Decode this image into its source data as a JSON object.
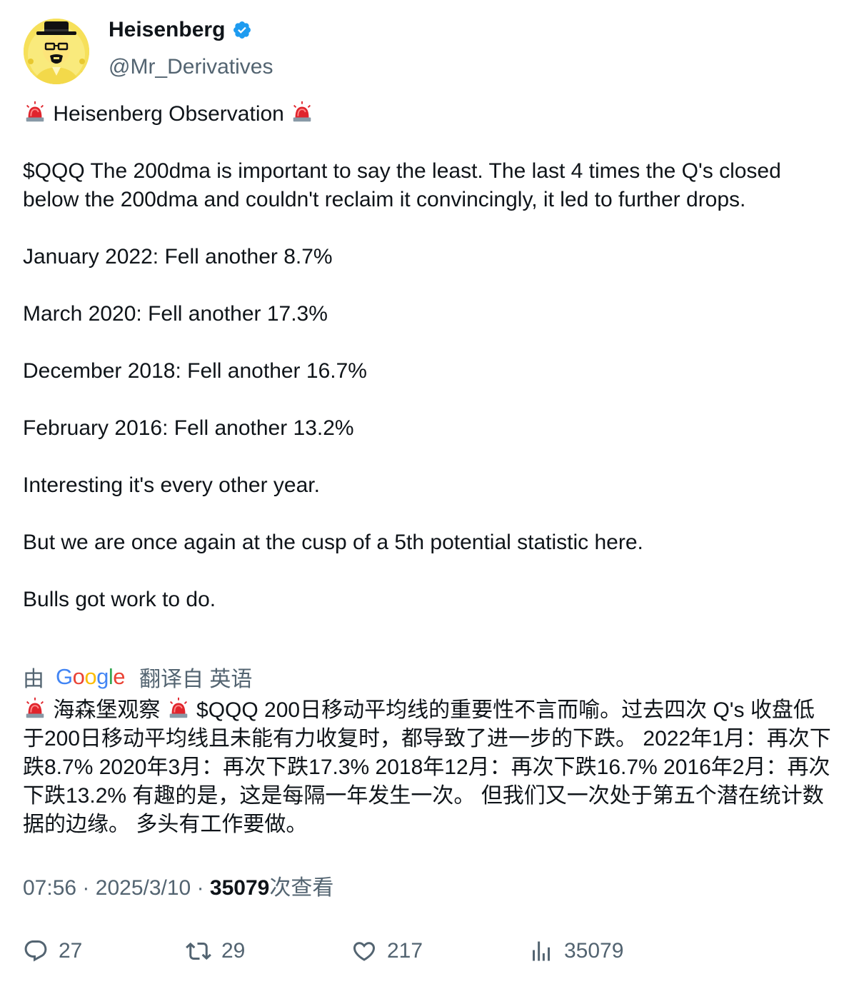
{
  "author": {
    "display_name": "Heisenberg",
    "handle": "@Mr_Derivatives",
    "verified": true,
    "avatar_icon": "heisenberg-avatar-icon"
  },
  "tweet": {
    "heading": "Heisenberg Observation",
    "paragraph1": "$QQQ The 200dma is important to say the least. The last 4 times the Q's closed below the 200dma and couldn't reclaim it convincingly, it led to further drops.",
    "line_jan": "January 2022: Fell another 8.7%",
    "line_mar": "March 2020: Fell another 17.3%",
    "line_dec": "December 2018: Fell another 16.7%",
    "line_feb": "February 2016: Fell another 13.2%",
    "line_interesting": "Interesting it's every other year.",
    "line_cusp": "But we are once again at the cusp of a 5th potential statistic here.",
    "line_bulls": "Bulls got work to do."
  },
  "translation": {
    "by_label": "由",
    "provider": "Google",
    "from_label": "翻译自 英语",
    "heading": "海森堡观察",
    "text": "$QQQ 200日移动平均线的重要性不言而喻。过去四次 Q's 收盘低于200日移动平均线且未能有力收复时，都导致了进一步的下跌。 2022年1月：再次下跌8.7% 2020年3月：再次下跌17.3% 2018年12月：再次下跌16.7% 2016年2月：再次下跌13.2% 有趣的是，这是每隔一年发生一次。 但我们又一次处于第五个潜在统计数据的边缘。 多头有工作要做。"
  },
  "meta": {
    "time": "07:56",
    "date": "2025/3/10",
    "separator": "·",
    "views_count": "35079",
    "views_label": "次查看"
  },
  "actions": {
    "replies": "27",
    "retweets": "29",
    "likes": "217",
    "views": "35079"
  },
  "colors": {
    "text": "#0f1419",
    "secondary": "#536471",
    "verified_blue": "#1d9bf0",
    "siren_red": "#e0242c"
  }
}
